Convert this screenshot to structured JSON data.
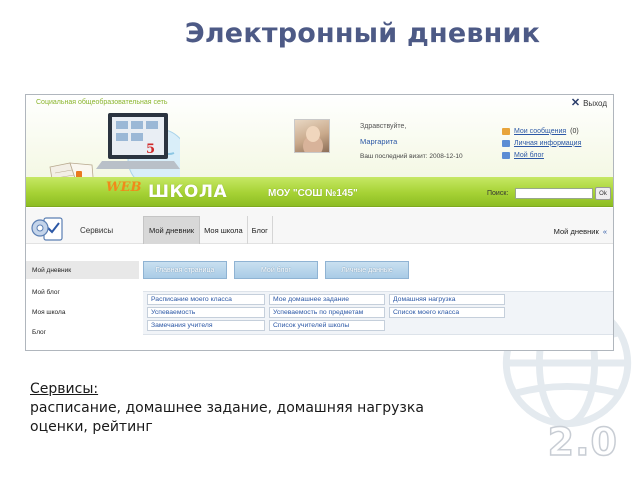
{
  "slide": {
    "title": "Электронный дневник",
    "caption_heading": "Сервисы:",
    "caption_line1": "расписание, домашнее задание, домашняя нагрузка",
    "caption_line2": "оценки, рейтинг",
    "version_label": "2.0"
  },
  "portal": {
    "network_label": "Социальная общеобразовательная сеть",
    "logout_label": "Выход",
    "greeting": "Здравствуйте,",
    "username": "Маргарита",
    "last_visit": "Ваш последний визит: 2008-12-10",
    "user_links": [
      {
        "label": "Мои сообщения",
        "count": "(0)",
        "icon": "envelope-icon"
      },
      {
        "label": "Личная информация",
        "count": "",
        "icon": "card-icon"
      },
      {
        "label": "Мой блог",
        "count": "",
        "icon": "blog-icon"
      }
    ],
    "web_logo": "WEB",
    "school_logo": "ШКОЛА",
    "school_name": "МОУ \"СОШ №145\"",
    "search_label": "Поиск:",
    "search_value": "",
    "search_button": "Ok",
    "services_label": "Сервисы",
    "tabs": [
      "Мой дневник",
      "Моя школа",
      "Блог"
    ],
    "active_tab": "Мой дневник",
    "breadcrumb_right": "Мой дневник",
    "breadcrumb_chevron": "«",
    "sidebar_items": [
      "Мой дневник",
      "Мой блог",
      "Моя школа",
      "Блог"
    ],
    "subtabs": [
      "Главная страница",
      "Мой блог",
      "Личные данные"
    ],
    "service_links": [
      [
        "Расписание моего класса",
        "Мое домашнее задание",
        "Домашняя нагрузка"
      ],
      [
        "Успеваемость",
        "Успеваемость по предметам",
        "Список моего класса"
      ],
      [
        "Замечания учителя",
        "Список учителей школы"
      ]
    ],
    "colors": {
      "brand_green": "#a6d235",
      "link_blue": "#2c58a6",
      "title_blue": "#4d5a86",
      "accent_orange": "#f08a1a"
    }
  }
}
